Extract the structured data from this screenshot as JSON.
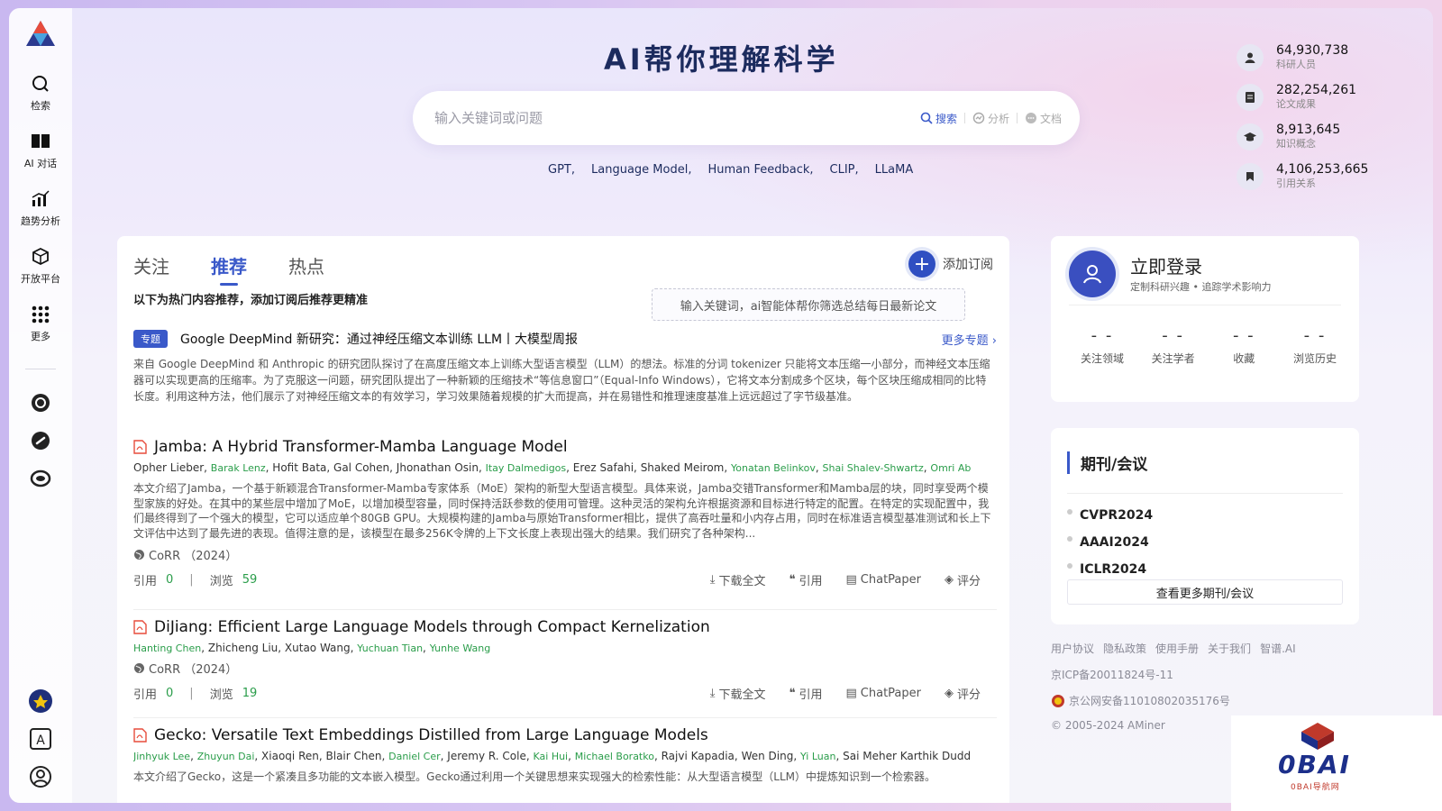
{
  "sidebar": {
    "items": [
      {
        "label": "检索",
        "icon": "search-icon"
      },
      {
        "label": "AI 对话",
        "icon": "book-icon"
      },
      {
        "label": "趋势分析",
        "icon": "chart-icon"
      },
      {
        "label": "开放平台",
        "icon": "cube-icon"
      },
      {
        "label": "更多",
        "icon": "grid-icon"
      }
    ]
  },
  "header": {
    "title": "AI帮你理解科学",
    "search_placeholder": "输入关键词或问题",
    "search_label": "搜索",
    "analyze_label": "分析",
    "doc_label": "文档",
    "hot_keywords": [
      "GPT,",
      "Language Model,",
      "Human Feedback,",
      "CLIP,",
      "LLaMA"
    ]
  },
  "stats": [
    {
      "value": "64,930,738",
      "label": "科研人员"
    },
    {
      "value": "282,254,261",
      "label": "论文成果"
    },
    {
      "value": "8,913,645",
      "label": "知识概念"
    },
    {
      "value": "4,106,253,665",
      "label": "引用关系"
    }
  ],
  "feed": {
    "tabs": [
      "关注",
      "推荐",
      "热点"
    ],
    "active_tab": 1,
    "subscribe_label": "添加订阅",
    "hint": "以下为热门内容推荐，添加订阅后推荐更精准",
    "tooltip": "输入关键词，ai智能体帮你筛选总结每日最新论文",
    "topic": {
      "badge": "专题",
      "title": "Google DeepMind 新研究：通过神经压缩文本训练 LLM丨大模型周报",
      "more": "更多专题",
      "desc": "来自 Google DeepMind 和 Anthropic 的研究团队探讨了在高度压缩文本上训练大型语言模型（LLM）的想法。标准的分词 tokenizer 只能将文本压缩一小部分，而神经文本压缩器可以实现更高的压缩率。为了克服这一问题，研究团队提出了一种新颖的压缩技术“等信息窗口”（Equal-Info Windows），它将文本分割成多个区块，每个区块压缩成相同的比特长度。利用这种方法，他们展示了对神经压缩文本的有效学习，学习效果随着规模的扩大而提高，并在易错性和推理速度基准上远远超过了字节级基准。"
    },
    "papers": [
      {
        "title": "Jamba: A Hybrid Transformer-Mamba Language Model",
        "authors": [
          {
            "name": "Opher Lieber",
            "linked": false
          },
          {
            "name": "Barak Lenz",
            "linked": true
          },
          {
            "name": "Hofit Bata",
            "linked": false
          },
          {
            "name": "Gal Cohen",
            "linked": false
          },
          {
            "name": "Jhonathan Osin",
            "linked": false
          },
          {
            "name": "Itay Dalmedigos",
            "linked": true
          },
          {
            "name": "Erez Safahi",
            "linked": false
          },
          {
            "name": "Shaked Meirom",
            "linked": false
          },
          {
            "name": "Yonatan Belinkov",
            "linked": true
          },
          {
            "name": "Shai Shalev-Shwartz",
            "linked": true
          },
          {
            "name": "Omri Ab",
            "linked": true
          }
        ],
        "abstract": "本文介绍了Jamba，一个基于新颖混合Transformer-Mamba专家体系（MoE）架构的新型大型语言模型。具体来说，Jamba交错Transformer和Mamba层的块，同时享受两个模型家族的好处。在其中的某些层中增加了MoE，以增加模型容量，同时保持活跃参数的使用可管理。这种灵活的架构允许根据资源和目标进行特定的配置。在特定的实现配置中，我们最终得到了一个强大的模型，它可以适应单个80GB GPU。大规模构建的Jamba与原始Transformer相比，提供了高吞吐量和小内存占用，同时在标准语言模型基准测试和长上下文评估中达到了最先进的表现。值得注意的是，该模型在最多256K令牌的上下文长度上表现出强大的结果。我们研究了各种架构...",
        "venue": "CoRR （2024）",
        "citations_label": "引用",
        "citations": "0",
        "views_label": "浏览",
        "views": "59"
      },
      {
        "title": "DiJiang: Efficient Large Language Models through Compact Kernelization",
        "authors": [
          {
            "name": "Hanting Chen",
            "linked": true
          },
          {
            "name": "Zhicheng Liu",
            "linked": false
          },
          {
            "name": "Xutao Wang",
            "linked": false
          },
          {
            "name": "Yuchuan Tian",
            "linked": true
          },
          {
            "name": "Yunhe Wang",
            "linked": true
          }
        ],
        "abstract": "",
        "venue": "CoRR （2024）",
        "citations_label": "引用",
        "citations": "0",
        "views_label": "浏览",
        "views": "19"
      },
      {
        "title": "Gecko: Versatile Text Embeddings Distilled from Large Language Models",
        "authors": [
          {
            "name": "Jinhyuk Lee",
            "linked": true
          },
          {
            "name": "Zhuyun Dai",
            "linked": true
          },
          {
            "name": "Xiaoqi Ren",
            "linked": false
          },
          {
            "name": "Blair Chen",
            "linked": false
          },
          {
            "name": "Daniel Cer",
            "linked": true
          },
          {
            "name": "Jeremy R. Cole",
            "linked": false
          },
          {
            "name": "Kai Hui",
            "linked": true
          },
          {
            "name": "Michael Boratko",
            "linked": true
          },
          {
            "name": "Rajvi Kapadia",
            "linked": false
          },
          {
            "name": "Wen Ding",
            "linked": false
          },
          {
            "name": "Yi Luan",
            "linked": true
          },
          {
            "name": "Sai Meher Karthik Dudd",
            "linked": false
          }
        ],
        "abstract": "本文介绍了Gecko，这是一个紧凑且多功能的文本嵌入模型。Gecko通过利用一个关键思想来实现强大的检索性能：从大型语言模型（LLM）中提炼知识到一个检索器。",
        "venue": "",
        "citations_label": "",
        "citations": "",
        "views_label": "",
        "views": ""
      }
    ],
    "actions": {
      "download": "下载全文",
      "cite": "引用",
      "chatpaper": "ChatPaper",
      "rate": "评分"
    }
  },
  "login": {
    "title": "立即登录",
    "subtitle": "定制科研兴趣 • 追踪学术影响力",
    "counters": [
      {
        "value": "- -",
        "label": "关注领域"
      },
      {
        "value": "- -",
        "label": "关注学者"
      },
      {
        "value": "- -",
        "label": "收藏"
      },
      {
        "value": "- -",
        "label": "浏览历史"
      }
    ]
  },
  "journals": {
    "heading": "期刊/会议",
    "items": [
      "CVPR2024",
      "AAAI2024",
      "ICLR2024"
    ],
    "more": "查看更多期刊/会议"
  },
  "footer": {
    "links": [
      "用户协议",
      "隐私政策",
      "使用手册",
      "关于我们",
      "智谱.AI"
    ],
    "icp": "京ICP备20011824号-11",
    "police": "京公网安备11010802035176号",
    "copyright": "© 2005-2024 AMiner"
  },
  "watermark": {
    "text": "0BAI",
    "sub": "0BAI导航网"
  },
  "colors": {
    "accent": "#3a59c9",
    "green": "#2a9d4a",
    "title": "#1c2b5e"
  }
}
